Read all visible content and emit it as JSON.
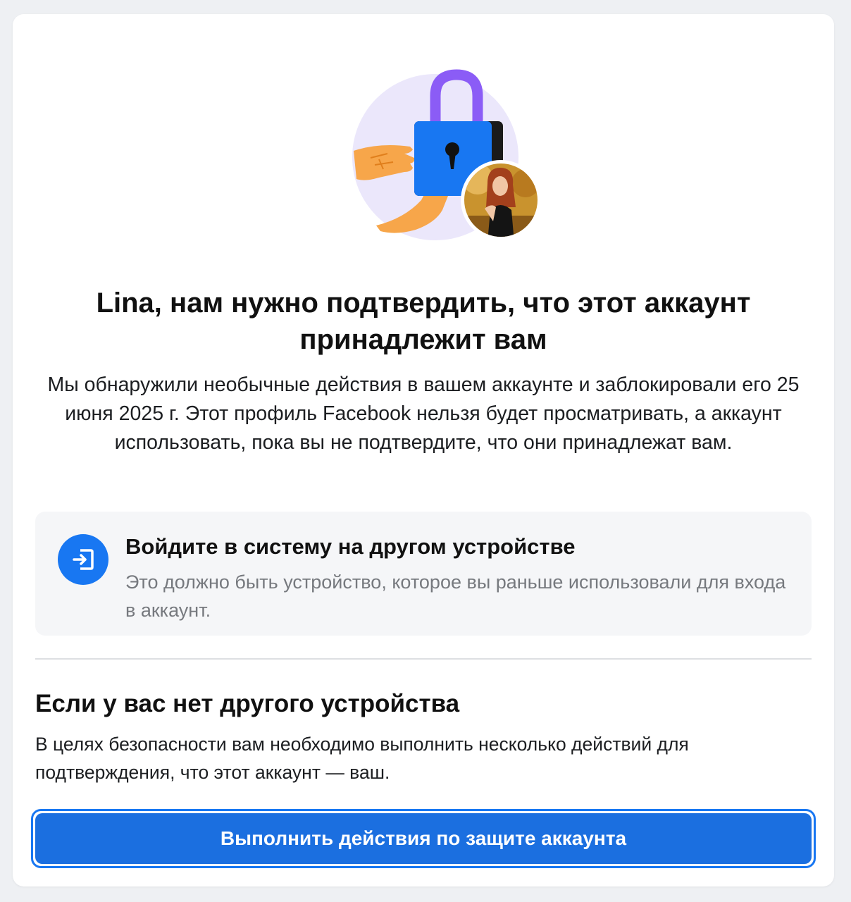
{
  "colors": {
    "accent": "#1877f2",
    "button_bg": "#1b6fe0",
    "card_bg": "#ffffff",
    "page_bg": "#eef0f3",
    "option_bg": "#f5f6f8",
    "muted_text": "#76797e",
    "lock_shackle": "#8b5cf6",
    "illustration_circle": "#ebe7fb",
    "hand": "#f7a64a"
  },
  "illustration": {
    "icons": [
      "lock-icon",
      "keyhole-icon",
      "hand-icon",
      "avatar"
    ]
  },
  "header": {
    "title": "Lina, нам нужно подтвердить, что этот аккаунт принадлежит вам",
    "subtitle": "Мы обнаружили необычные действия в вашем аккаунте и заблокировали его 25 июня 2025 г. Этот профиль Facebook нельзя будет просматривать, а аккаунт использовать, пока вы не подтвердите, что они принадлежат вам."
  },
  "option": {
    "icon": "login-icon",
    "title": "Войдите в систему на другом устройстве",
    "description": "Это должно быть устройство, которое вы раньше использовали для входа в аккаунт."
  },
  "alternative": {
    "title": "Если у вас нет другого устройства",
    "description": "В целях безопасности вам необходимо выполнить несколько действий для подтверждения, что этот аккаунт — ваш.",
    "button_label": "Выполнить действия по защите аккаунта"
  }
}
